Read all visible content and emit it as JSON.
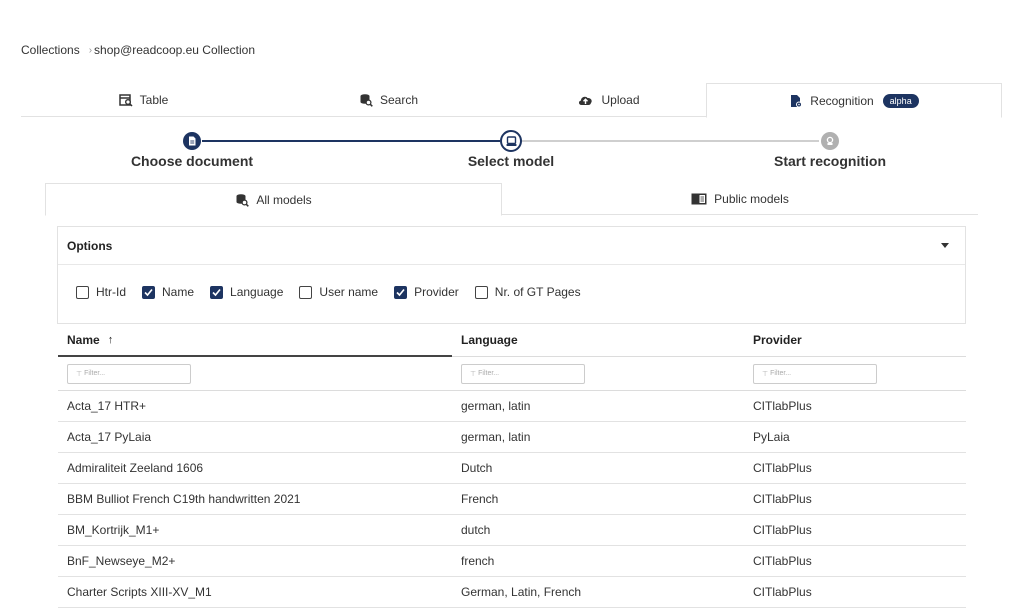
{
  "breadcrumb": {
    "root": "Collections",
    "current": "shop@readcoop.eu Collection"
  },
  "top_tabs": [
    {
      "label": "Table",
      "icon": "table-search-icon"
    },
    {
      "label": "Search",
      "icon": "database-search-icon"
    },
    {
      "label": "Upload",
      "icon": "cloud-upload-icon"
    },
    {
      "label": "Recognition",
      "icon": "document-settings-icon",
      "badge": "alpha",
      "active": true
    }
  ],
  "stepper": {
    "steps": [
      {
        "label": "Choose document",
        "state": "done"
      },
      {
        "label": "Select model",
        "state": "active"
      },
      {
        "label": "Start recognition",
        "state": "pending"
      }
    ]
  },
  "model_tabs": [
    {
      "label": "All models",
      "active": true
    },
    {
      "label": "Public models",
      "active": false
    }
  ],
  "options": {
    "title": "Options",
    "checkboxes": [
      {
        "label": "Htr-Id",
        "checked": false
      },
      {
        "label": "Name",
        "checked": true
      },
      {
        "label": "Language",
        "checked": true
      },
      {
        "label": "User name",
        "checked": false
      },
      {
        "label": "Provider",
        "checked": true
      },
      {
        "label": "Nr. of GT Pages",
        "checked": false
      }
    ]
  },
  "table": {
    "columns": [
      "Name",
      "Language",
      "Provider"
    ],
    "sort_indicator": "↑",
    "filter_placeholder": "Filter...",
    "rows": [
      [
        "Acta_17 HTR+",
        "german, latin",
        "CITlabPlus"
      ],
      [
        "Acta_17 PyLaia",
        "german, latin",
        "PyLaia"
      ],
      [
        "Admiraliteit Zeeland 1606",
        "Dutch",
        "CITlabPlus"
      ],
      [
        "BBM Bulliot French C19th handwritten 2021",
        "French",
        "CITlabPlus"
      ],
      [
        "BM_Kortrijk_M1+",
        "dutch",
        "CITlabPlus"
      ],
      [
        "BnF_Newseye_M2+",
        "french",
        "CITlabPlus"
      ],
      [
        "Charter Scripts XIII-XV_M1",
        "German, Latin, French",
        "CITlabPlus"
      ]
    ]
  },
  "colors": {
    "accent": "#1d3461",
    "pending": "#b0b0b0",
    "border": "#e2e2e2"
  }
}
